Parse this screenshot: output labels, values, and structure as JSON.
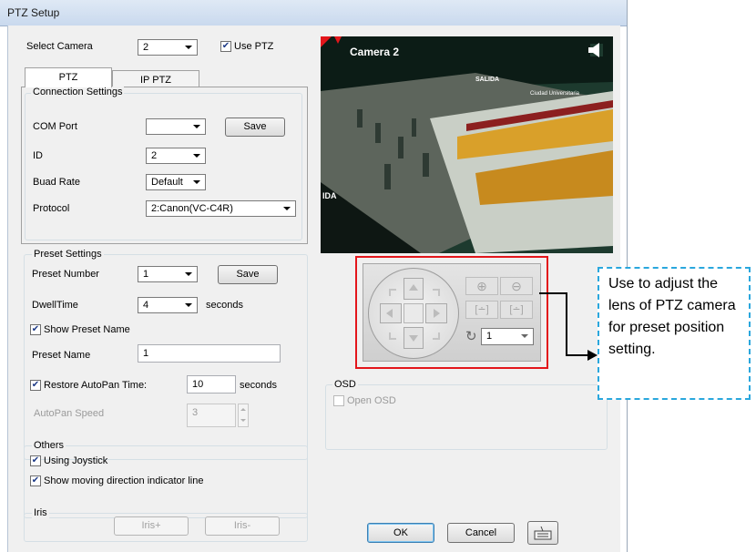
{
  "window": {
    "title": "PTZ Setup"
  },
  "camera": {
    "label": "Select Camera",
    "value": "2",
    "use_ptz_label": "Use PTZ",
    "use_ptz_checked": true
  },
  "tabs": [
    {
      "label": "PTZ",
      "active": true
    },
    {
      "label": "IP PTZ",
      "active": false
    }
  ],
  "connection": {
    "title": "Connection Settings",
    "com_port_label": "COM Port",
    "com_port_value": "",
    "save_label": "Save",
    "id_label": "ID",
    "id_value": "2",
    "baud_label": "Buad Rate",
    "baud_value": "Default",
    "protocol_label": "Protocol",
    "protocol_value": "2:Canon(VC-C4R)"
  },
  "preset": {
    "title": "Preset Settings",
    "number_label": "Preset Number",
    "number_value": "1",
    "save_label": "Save",
    "dwell_label": "DwellTime",
    "dwell_value": "4",
    "dwell_unit": "seconds",
    "show_name_label": "Show Preset Name",
    "show_name_checked": true,
    "name_label": "Preset Name",
    "name_value": "1",
    "restore_label": "Restore AutoPan Time:",
    "restore_checked": true,
    "restore_value": "10",
    "restore_unit": "seconds",
    "speed_label": "AutoPan Speed",
    "speed_value": "3"
  },
  "others": {
    "title": "Others",
    "joystick_label": "Using Joystick",
    "joystick_checked": true,
    "direction_label": "Show moving direction indicator line",
    "direction_checked": true
  },
  "iris": {
    "title": "Iris",
    "plus_label": "Iris+",
    "minus_label": "Iris-"
  },
  "preview": {
    "camera_label": "Camera 2",
    "sign1": "SALIDA",
    "sign2": "Ciudad Universitaria",
    "sign3": "IDA"
  },
  "ptz_control": {
    "speed_value": "1"
  },
  "osd": {
    "title": "OSD",
    "open_label": "Open OSD",
    "open_checked": false
  },
  "buttons": {
    "ok": "OK",
    "cancel": "Cancel"
  },
  "callout": {
    "text": "Use to adjust the lens of PTZ camera for preset position setting."
  },
  "colors": {
    "highlight": "#e3161b",
    "callout_border": "#2aa7dd"
  }
}
